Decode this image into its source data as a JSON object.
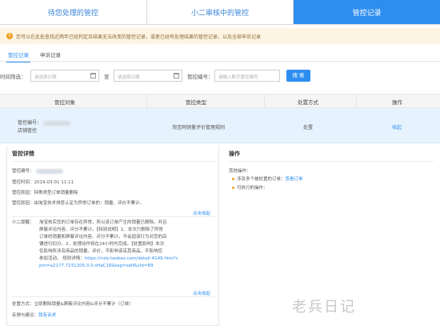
{
  "tabs": [
    {
      "label": "待您处理的管控"
    },
    {
      "label": "小二审核中的管控"
    },
    {
      "label": "管控记录"
    }
  ],
  "notice": {
    "icon": "info-icon",
    "text": "您可以在此处查找近两年已经判定且结果无法改变的管控记录，或者已经有处理结果的管控记录，以及全部申诉记录"
  },
  "subtabs": [
    {
      "label": "管控记录"
    },
    {
      "label": "申诉记录"
    }
  ],
  "filters": {
    "time_label": "时间筛选：",
    "start_placeholder": "请选择日期",
    "to_label": "至",
    "end_placeholder": "请选择日期",
    "id_label": "管控编号：",
    "id_placeholder": "请输入数字管控编号",
    "search_label": "搜 索"
  },
  "table": {
    "headers": [
      "管控对象",
      "管控类型",
      "处置方式",
      "操作"
    ],
    "row": {
      "object_line1": "管控编号：",
      "object_line2": "店铺管控",
      "type": "淘宝网销量评价管理规则",
      "action": "处置",
      "op": "收起"
    }
  },
  "detail": {
    "title": "管控详情",
    "id_label": "管控编号：",
    "time": "管控时间：2019-03-01 11:11",
    "reason": "管控原因：特殊类型订单销量删除",
    "cause": "管控原因：由淘宝技术排查认定为异常订单的：销量、评价不累计。",
    "collapse1": "点击收起",
    "reminder_label": "小二提醒：",
    "reminder_lines": [
      "淘宝核实您的订单存在异常，所以该订单产生的销量已删除，并且",
      "屏蔽评论内容、评分不累计。【特别说明】1、本次只删除了异常",
      "订单的销量和屏蔽评论内容、评分不累计，不会因该行为对您的店",
      "铺进行扣分。2、处理动作将在24小时内完成。【处置影响】本次",
      "仅影响所涉及商品的销量、评价，不影响该店其商品，不影响您",
      "参加活动。 规则详情："
    ],
    "rule_link_1": "https://rule.taobao.com/detail-4149.htm?s",
    "rule_link_2": "pm=a2177.7231205.0.0.sHaC1R&tag=self&cId=89",
    "collapse2": "点击收起",
    "disposal": "处置方式：立即删除销量&屏蔽评论内容&评分不累计（订单）",
    "feedback_label": "反馈与建议：",
    "feedback_link": "我有诉求"
  },
  "ops": {
    "title": "操作",
    "other_label": "其他操作：",
    "items": [
      {
        "text": "涉及多个被处置的订单：",
        "link": "查看订单"
      },
      {
        "text": "可执行的操作：",
        "link": ""
      }
    ]
  },
  "watermark": "老兵日记",
  "colors": {
    "primary": "#2e8ef0",
    "notice_bg": "#fdf4e3",
    "row_bg": "#e6f2fd"
  }
}
